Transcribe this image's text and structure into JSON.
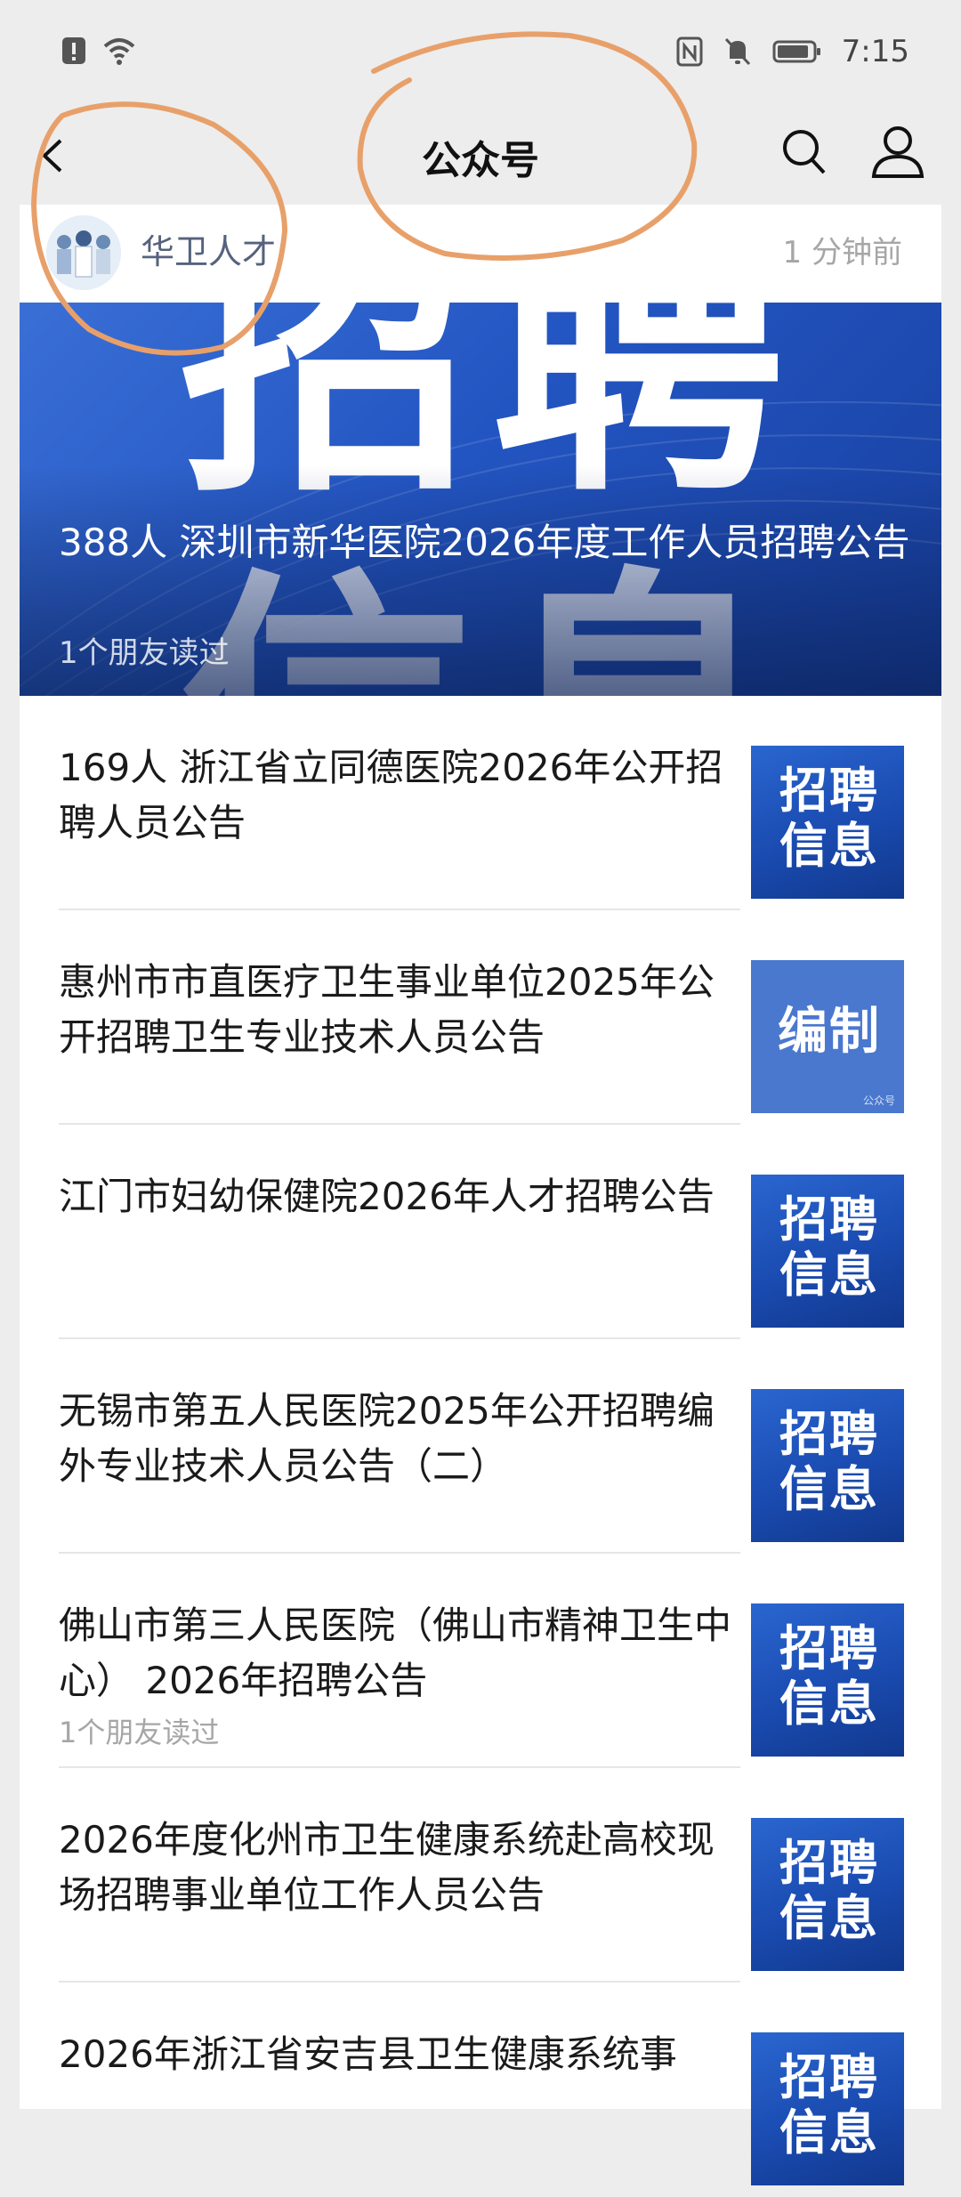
{
  "status_bar": {
    "time": "7:15",
    "icons": [
      "alert-icon",
      "wifi-icon",
      "nfc-icon",
      "mute-icon",
      "battery-icon"
    ]
  },
  "nav": {
    "title": "公众号",
    "icons": [
      "back-icon",
      "search-icon",
      "user-icon"
    ]
  },
  "account": {
    "name": "华卫人才",
    "time": "1 分钟前"
  },
  "hero": {
    "bg_text_top": "招聘",
    "bg_text_bottom": "信息",
    "title": "388人 深圳市新华医院2026年度工作人员招聘公告",
    "meta": "1个朋友读过"
  },
  "articles": [
    {
      "title": "169人 浙江省立同德医院2026年公开招聘人员公告",
      "meta": "",
      "thumb_text": "招聘信息",
      "thumb_style": "recruit"
    },
    {
      "title": "惠州市市直医疗卫生事业单位2025年公开招聘卫生专业技术人员公告",
      "meta": "",
      "thumb_text": "编制",
      "thumb_style": "plain",
      "thumb_foot": "公众号"
    },
    {
      "title": "江门市妇幼保健院2026年人才招聘公告",
      "meta": "",
      "thumb_text": "招聘信息",
      "thumb_style": "recruit"
    },
    {
      "title": "无锡市第五人民医院2025年公开招聘编外专业技术人员公告（二）",
      "meta": "",
      "thumb_text": "招聘信息",
      "thumb_style": "recruit"
    },
    {
      "title": "佛山市第三人民医院（佛山市精神卫生中心） 2026年招聘公告",
      "meta": "1个朋友读过",
      "thumb_text": "招聘信息",
      "thumb_style": "recruit"
    },
    {
      "title": "2026年度化州市卫生健康系统赴高校现场招聘事业单位工作人员公告",
      "meta": "",
      "thumb_text": "招聘信息",
      "thumb_style": "recruit"
    },
    {
      "title": "2026年浙江省安吉县卫生健康系统事",
      "meta": "",
      "thumb_text": "招聘信息",
      "thumb_style": "recruit"
    }
  ],
  "colors": {
    "annotation": "#e8a06a",
    "accent_blue": "#1a4bb0",
    "account_name": "#56627d"
  }
}
